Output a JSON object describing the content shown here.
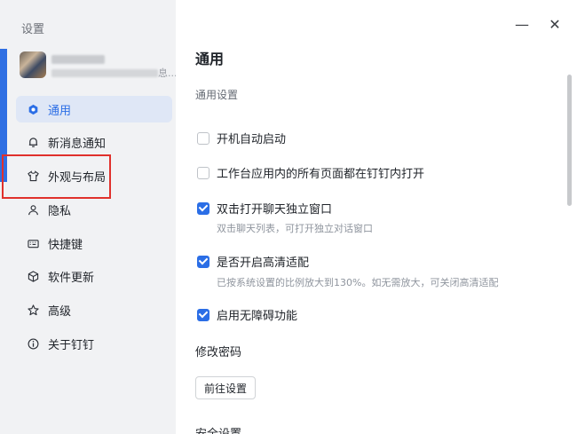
{
  "sidebar": {
    "title": "设置",
    "profile": {
      "desc_tail": "息..."
    },
    "items": [
      {
        "label": "通用",
        "icon": "hexagon-gear-icon",
        "active": true
      },
      {
        "label": "新消息通知",
        "icon": "bell-icon"
      },
      {
        "label": "外观与布局",
        "icon": "shirt-icon"
      },
      {
        "label": "隐私",
        "icon": "person-icon"
      },
      {
        "label": "快捷键",
        "icon": "keyboard-icon"
      },
      {
        "label": "软件更新",
        "icon": "cube-icon"
      },
      {
        "label": "高级",
        "icon": "star-icon"
      },
      {
        "label": "关于钉钉",
        "icon": "info-icon"
      }
    ]
  },
  "window": {
    "minimize": "—",
    "close": "✕"
  },
  "main": {
    "title": "通用",
    "section_general": "通用设置",
    "options": [
      {
        "label": "开机自动启动",
        "checked": false
      },
      {
        "label": "工作台应用内的所有页面都在钉钉内打开",
        "checked": false
      },
      {
        "label": "双击打开聊天独立窗口",
        "checked": true,
        "hint": "双击聊天列表，可打开独立对话窗口"
      },
      {
        "label": "是否开启高清适配",
        "checked": true,
        "hint": "已按系统设置的比例放大到130%。如无需放大，可关闭高清适配"
      },
      {
        "label": "启用无障碍功能",
        "checked": true
      }
    ],
    "section_password": "修改密码",
    "goto_button": "前往设置",
    "section_security": "安全设置"
  },
  "colors": {
    "accent": "#2b6ee6",
    "highlight": "#e0312c"
  }
}
